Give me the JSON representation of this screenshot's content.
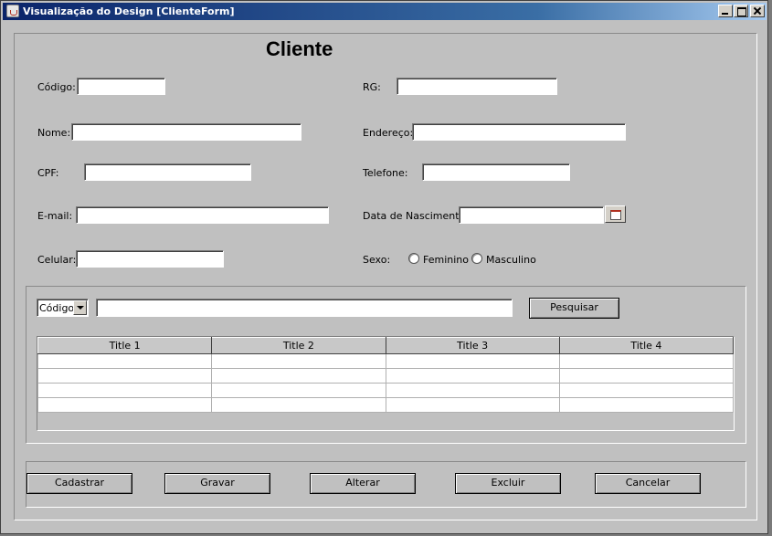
{
  "window": {
    "title": "Visualização do Design [ClienteForm]"
  },
  "form": {
    "title": "Cliente",
    "labels": {
      "codigo": "Código:",
      "rg": "RG:",
      "nome": "Nome:",
      "endereco": "Endereço:",
      "cpf": "CPF:",
      "telefone": "Telefone:",
      "email": "E-mail:",
      "data_nascimento": "Data de Nascimento:",
      "celular": "Celular:",
      "sexo": "Sexo:"
    },
    "values": {
      "codigo": "",
      "rg": "",
      "nome": "",
      "endereco": "",
      "cpf": "",
      "telefone": "",
      "email": "",
      "data_nascimento": "",
      "celular": ""
    },
    "sexo_options": [
      "Feminino",
      "Masculino"
    ]
  },
  "search": {
    "filter_selected": "Código",
    "query": "",
    "button_label": "Pesquisar"
  },
  "table": {
    "columns": [
      "Title 1",
      "Title 2",
      "Title 3",
      "Title 4"
    ],
    "rows": [
      [
        "",
        "",
        "",
        ""
      ],
      [
        "",
        "",
        "",
        ""
      ],
      [
        "",
        "",
        "",
        ""
      ],
      [
        "",
        "",
        "",
        ""
      ]
    ]
  },
  "actions": {
    "cadastrar": "Cadastrar",
    "gravar": "Gravar",
    "alterar": "Alterar",
    "excluir": "Excluir",
    "cancelar": "Cancelar"
  },
  "icons": {
    "app": "java-cup-icon",
    "minimize": "minimize-icon",
    "maximize": "maximize-icon",
    "close": "close-icon",
    "calendar": "calendar-icon",
    "dropdown": "chevron-down-icon"
  }
}
